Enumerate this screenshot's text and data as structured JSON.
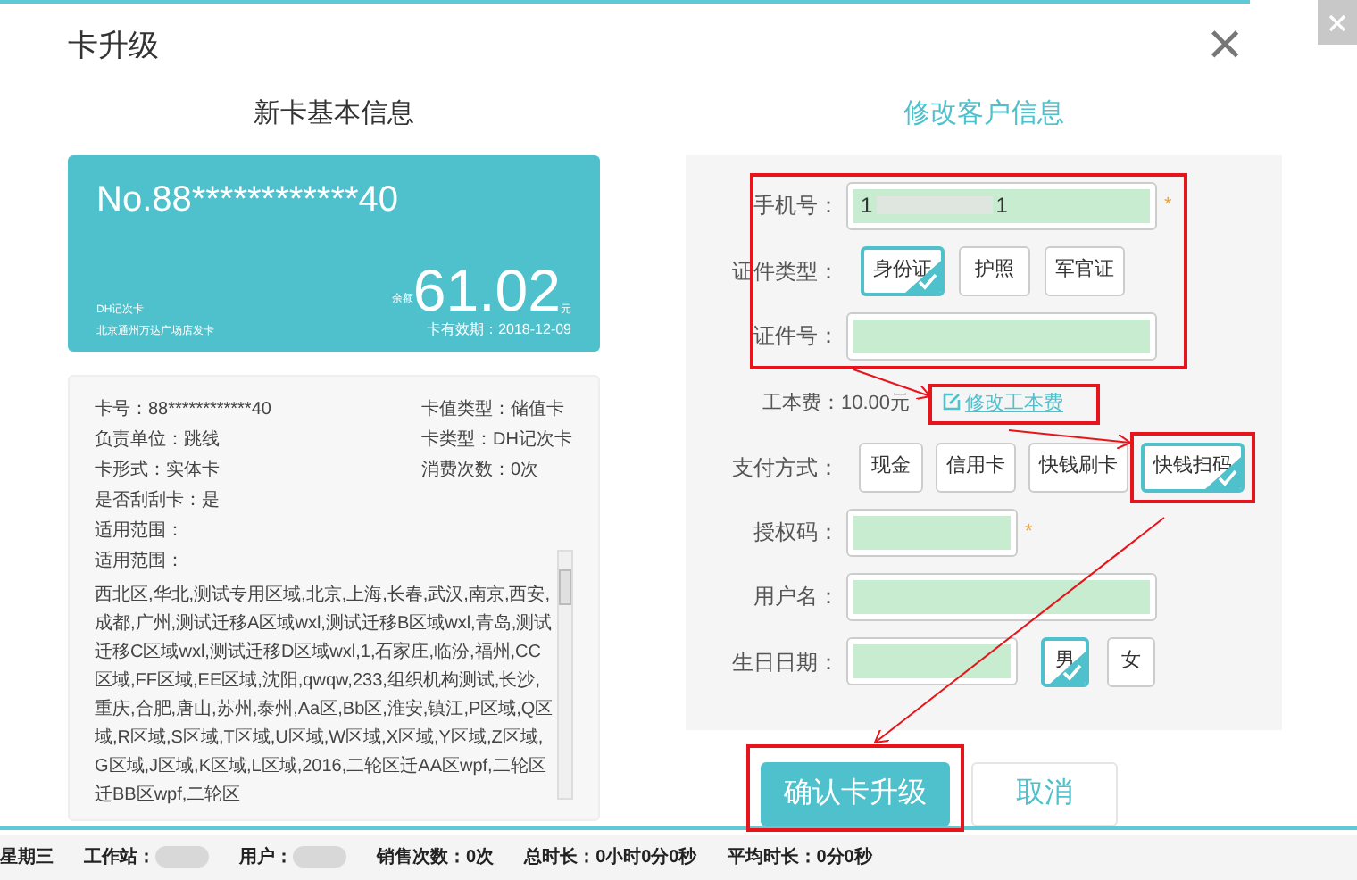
{
  "dialog": {
    "title": "卡升级",
    "close": "×"
  },
  "card_info": {
    "heading": "新卡基本信息",
    "card_no": "No.88************40",
    "card_type": "DH记次卡",
    "issuer": "北京通州万达广场店发卡",
    "balance_label": "余额",
    "balance": "61.02",
    "balance_unit": "元",
    "expiry": "卡有效期：2018-12-09"
  },
  "details": {
    "pairs": [
      [
        "卡号：88************40",
        "卡值类型：储值卡"
      ],
      [
        "负责单位：跳线",
        "卡类型：DH记次卡"
      ],
      [
        "卡形式：实体卡",
        "消费次数：0次"
      ]
    ],
    "lines": [
      "是否刮刮卡：是",
      "适用范围："
    ],
    "scope_label": "适用范围：",
    "scope_text": "西北区,华北,测试专用区域,北京,上海,长春,武汉,南京,西安,成都,广州,测试迁移A区域wxl,测试迁移B区域wxl,青岛,测试迁移C区域wxl,测试迁移D区域wxl,1,石家庄,临汾,福州,CC区域,FF区域,EE区域,沈阳,qwqw,233,组织机构测试,长沙,重庆,合肥,唐山,苏州,泰州,Aa区,Bb区,淮安,镇江,P区域,Q区域,R区域,S区域,T区域,U区域,W区域,X区域,Y区域,Z区域,G区域,J区域,K区域,L区域,2016,二轮区迁AA区wpf,二轮区迁BB区wpf,二轮区"
  },
  "form": {
    "heading": "修改客户信息",
    "phone": {
      "label": "手机号：",
      "value_start": "1",
      "value_end": "1",
      "mark": "*",
      "required": true
    },
    "id_type": {
      "label": "证件类型：",
      "options": [
        {
          "label": "身份证",
          "selected": true
        },
        {
          "label": "护照",
          "selected": false
        },
        {
          "label": "军官证",
          "selected": false
        }
      ]
    },
    "id_no": {
      "label": "证件号："
    },
    "fee": {
      "label": "工本费：10.00元",
      "link": "修改工本费"
    },
    "payment": {
      "label": "支付方式：",
      "options": [
        {
          "label": "现金",
          "selected": false
        },
        {
          "label": "信用卡",
          "selected": false
        },
        {
          "label": "快钱刷卡",
          "selected": false
        },
        {
          "label": "快钱扫码",
          "selected": true
        }
      ]
    },
    "auth_code": {
      "label": "授权码：",
      "mark": "*",
      "required": true
    },
    "username": {
      "label": "用户名："
    },
    "birthday": {
      "label": "生日日期：",
      "gender": [
        {
          "label": "男",
          "selected": true
        },
        {
          "label": "女",
          "selected": false
        }
      ]
    }
  },
  "buttons": {
    "confirm": "确认卡升级",
    "cancel": "取消"
  },
  "status_bar": [
    {
      "text": "星期三",
      "redacted": false
    },
    {
      "text": "工作站：",
      "redacted": true
    },
    {
      "text": "用户：",
      "redacted": true
    },
    {
      "text": "销售次数：0次",
      "redacted": false
    },
    {
      "text": "总时长：0小时0分0秒",
      "redacted": false
    },
    {
      "text": "平均时长：0分0秒",
      "redacted": false
    }
  ]
}
